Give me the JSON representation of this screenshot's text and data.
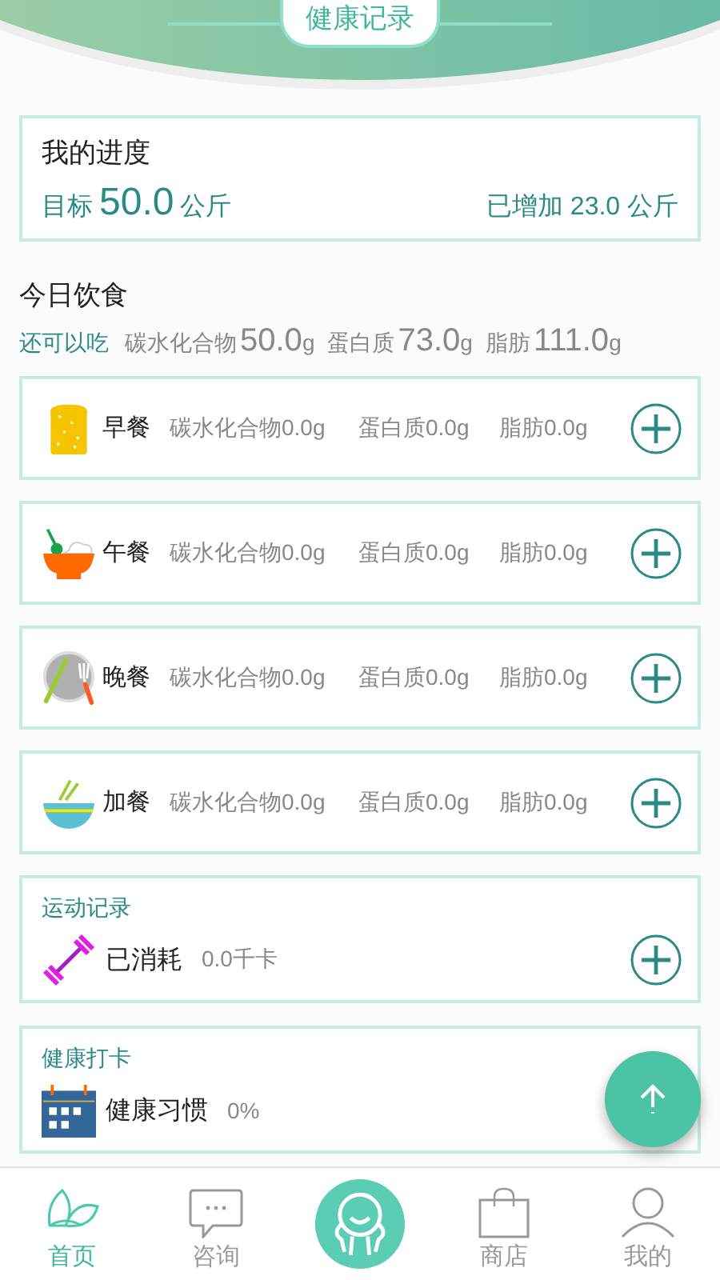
{
  "header": {
    "title": "健康记录"
  },
  "progress": {
    "title": "我的进度",
    "target_label": "目标",
    "target_value": "50.0",
    "target_unit": "公斤",
    "gained": "已增加 23.0 公斤"
  },
  "diet": {
    "title": "今日饮食",
    "remaining_label": "还可以吃",
    "macros": [
      {
        "label": "碳水化合物",
        "value": "50.0",
        "unit": "g"
      },
      {
        "label": "蛋白质",
        "value": "73.0",
        "unit": "g"
      },
      {
        "label": "脂肪",
        "value": "111.0",
        "unit": "g"
      }
    ]
  },
  "meals": [
    {
      "kind": "breakfast",
      "name": "早餐",
      "carbs": "碳水化合物0.0g",
      "protein": "蛋白质0.0g",
      "fat": "脂肪0.0g"
    },
    {
      "kind": "lunch",
      "name": "午餐",
      "carbs": "碳水化合物0.0g",
      "protein": "蛋白质0.0g",
      "fat": "脂肪0.0g"
    },
    {
      "kind": "dinner",
      "name": "晚餐",
      "carbs": "碳水化合物0.0g",
      "protein": "蛋白质0.0g",
      "fat": "脂肪0.0g"
    },
    {
      "kind": "snack",
      "name": "加餐",
      "carbs": "碳水化合物0.0g",
      "protein": "蛋白质0.0g",
      "fat": "脂肪0.0g"
    }
  ],
  "exercise": {
    "title": "运动记录",
    "label": "已消耗",
    "value": "0.0千卡"
  },
  "checkin": {
    "title": "健康打卡",
    "label": "健康习惯",
    "value": "0%"
  },
  "nav": [
    {
      "kind": "home",
      "label": "首页",
      "selected": true
    },
    {
      "kind": "chat",
      "label": "咨询",
      "selected": false
    },
    {
      "kind": "center",
      "selected": false
    },
    {
      "kind": "shop",
      "label": "商店",
      "selected": false
    },
    {
      "kind": "profile",
      "label": "我的",
      "selected": false
    }
  ]
}
